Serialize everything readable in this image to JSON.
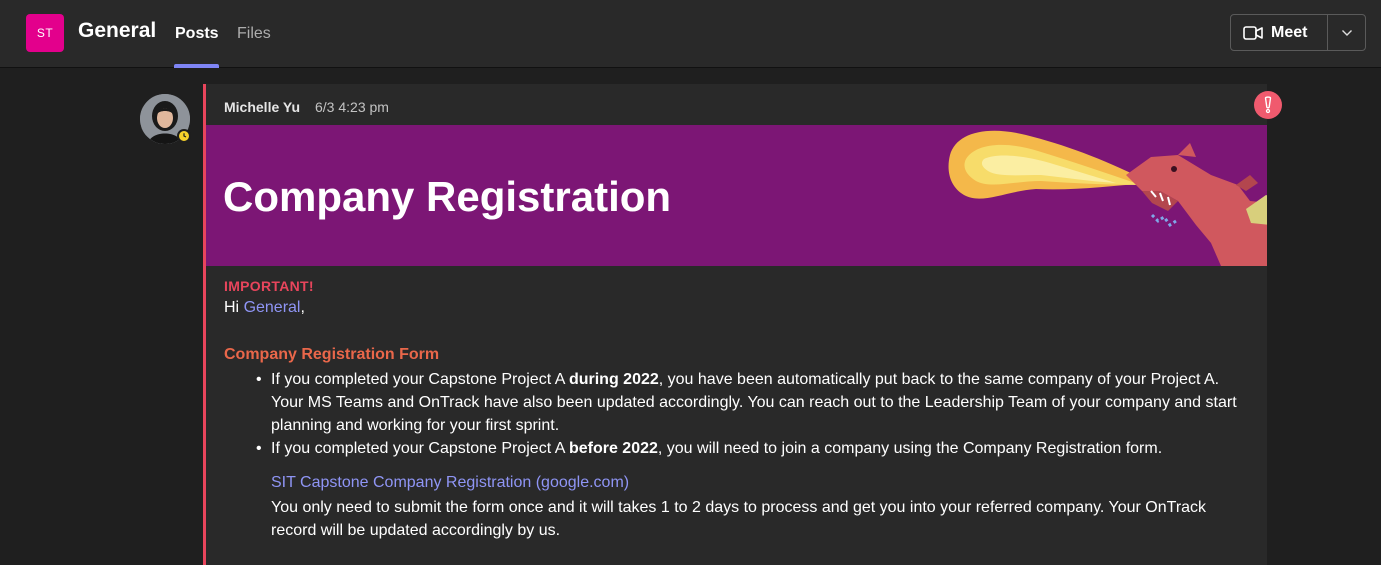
{
  "header": {
    "team_initials": "ST",
    "channel": "General",
    "tabs": [
      {
        "label": "Posts",
        "active": true
      },
      {
        "label": "Files",
        "active": false
      }
    ],
    "meet_label": "Meet"
  },
  "post": {
    "author": "Michelle Yu",
    "timestamp": "6/3 4:23 pm",
    "banner_title": "Company Registration",
    "important_label": "IMPORTANT!",
    "greeting_prefix": "Hi ",
    "mention": "General",
    "greeting_suffix": ",",
    "section_title": "Company Registration Form",
    "bullet1": {
      "pre": "If you completed your Capstone Project A ",
      "bold": "during 2022",
      "post": ", you have been automatically put back to the same company of your Project A. Your MS Teams and OnTrack have also been updated accordingly. You can reach out to the Leadership Team of your company and start planning and working for your first sprint."
    },
    "bullet2": {
      "pre": "If you completed your Capstone Project A ",
      "bold": "before 2022",
      "post": ", you will need to join a company using the Company Registration form."
    },
    "link_text": "SIT Capstone Company Registration (google.com)",
    "note": "You only need to submit the form once and it will takes 1 to 2 days to process and get you into your referred company. Your OnTrack record will be updated accordingly by us."
  },
  "colors": {
    "accent": "#7f85f5",
    "team_avatar": "#e3008c",
    "banner": "#7c1675",
    "urgent": "#f05a6e",
    "important_text": "#e8455c",
    "section_title": "#e9674a"
  },
  "icons": {
    "meet": "video-camera-icon",
    "dropdown": "chevron-down-icon",
    "urgent": "exclamation-icon",
    "presence": "clock-icon"
  }
}
